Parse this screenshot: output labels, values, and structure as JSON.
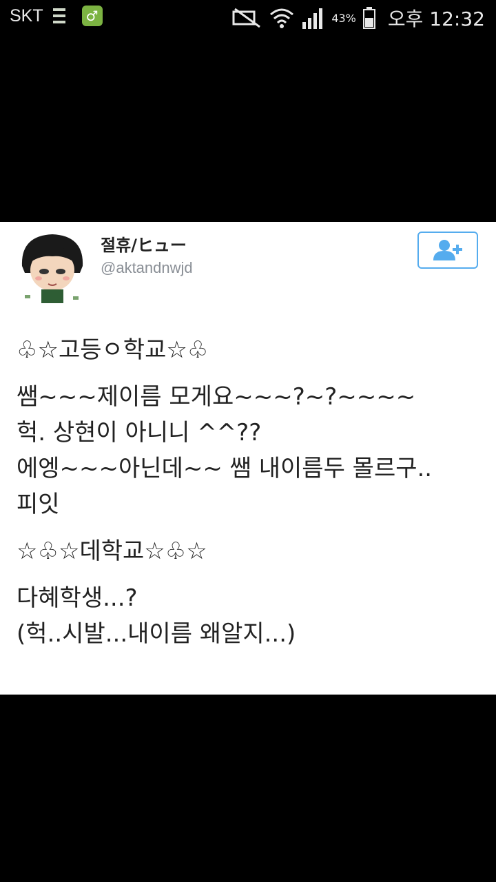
{
  "status_bar": {
    "carrier": "SKT",
    "battery_percent": "43%",
    "time": "오후 12:32"
  },
  "tweet": {
    "display_name": "절휴/ヒュー",
    "handle": "@aktandnwjd",
    "lines": [
      "♧☆고등ㅇ학교☆♧",
      "쌤~~~제이름 모게요~~~?~?~~~~",
      "헉. 상현이 아니니 ^^??",
      "에엥~~~아닌데~~ 쌤 내이름두 몰르구..",
      "피잇",
      "☆♧☆데학교☆♧☆",
      "다혜학생...?",
      "(헉..시발...내이름 왜알지...)"
    ]
  },
  "colors": {
    "twitter_blue": "#55acee",
    "background": "#000000",
    "card": "#ffffff"
  }
}
